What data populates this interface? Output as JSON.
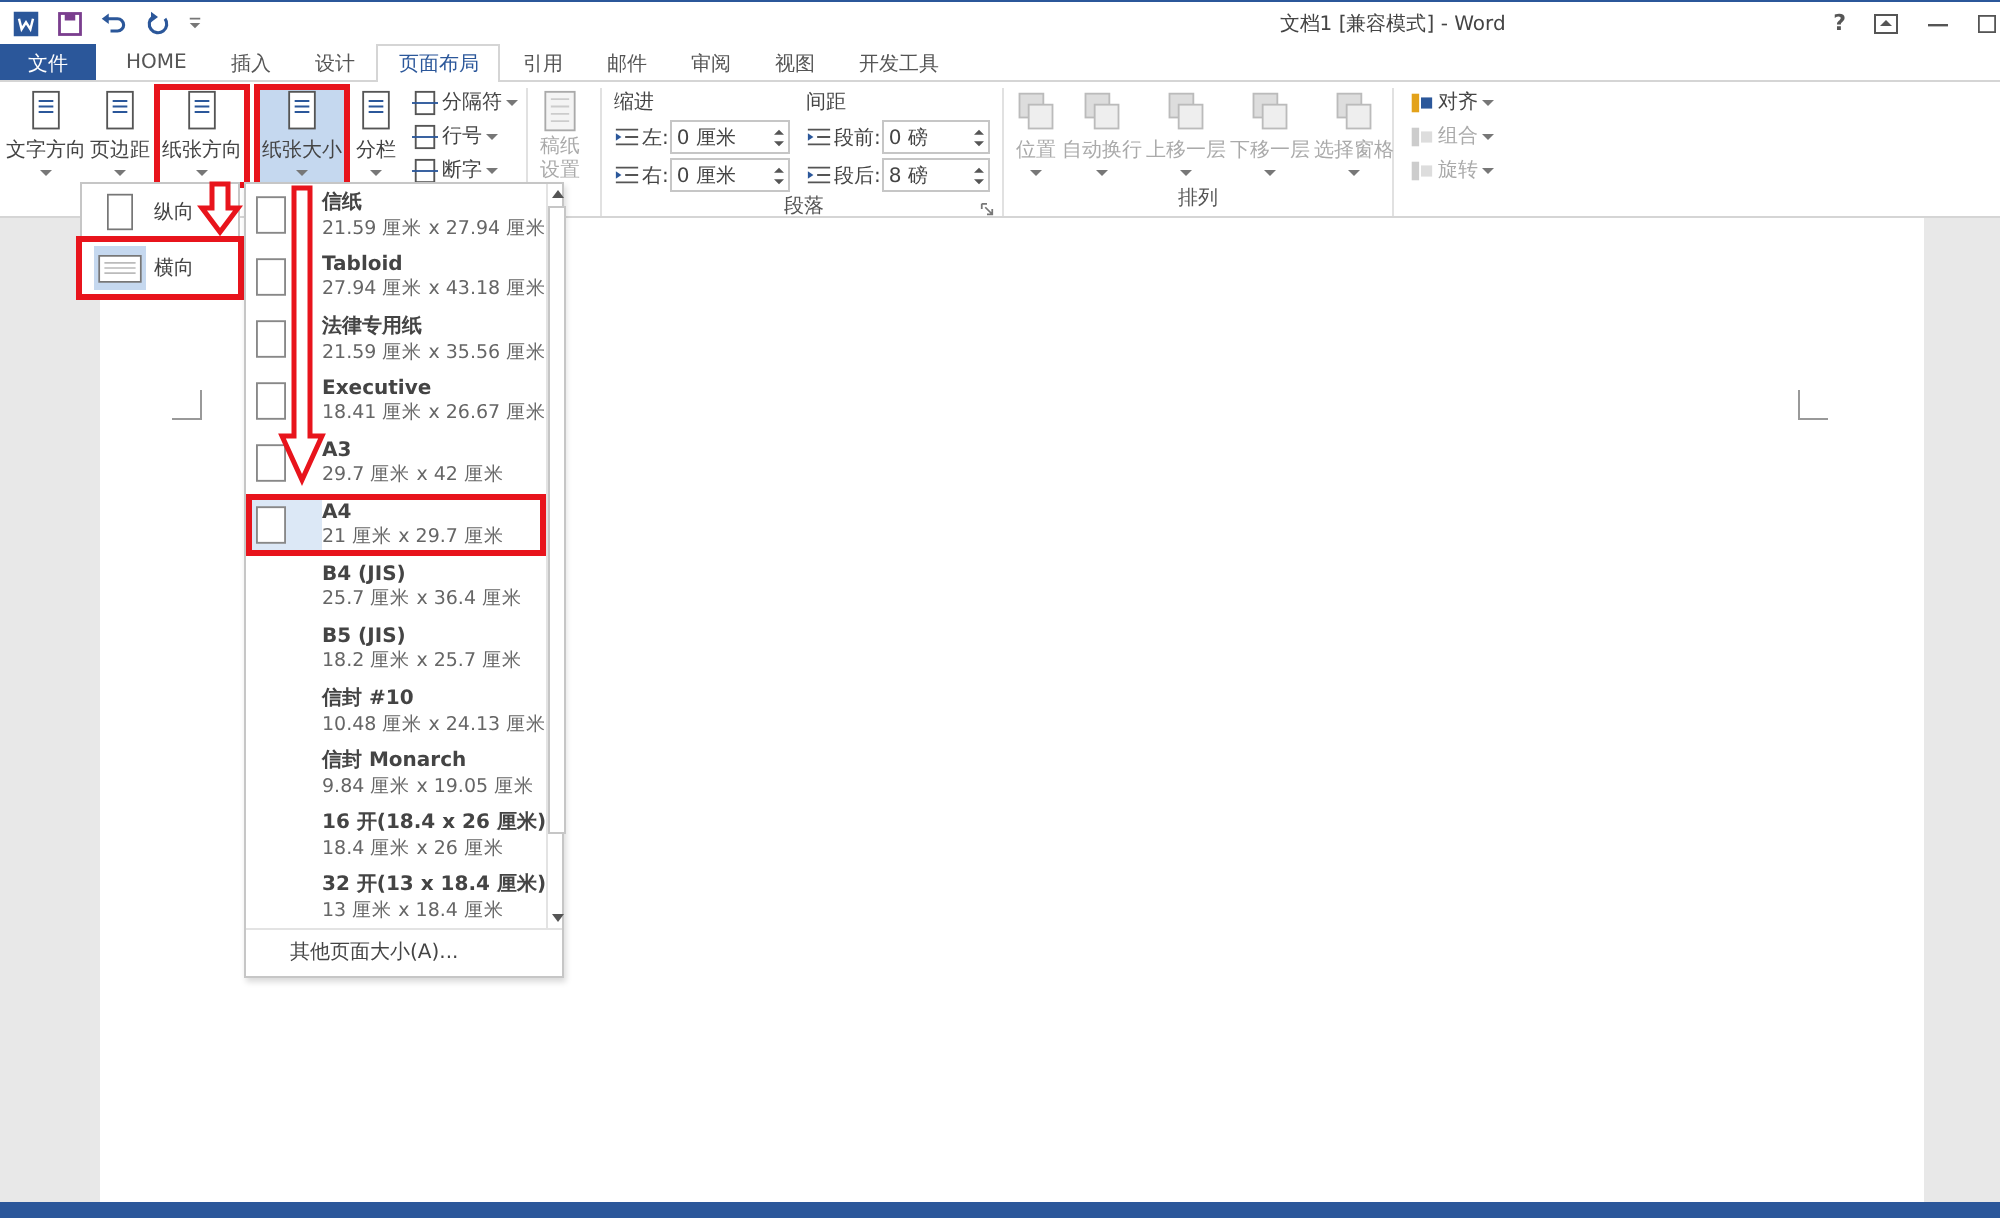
{
  "title_bar": {
    "title": "文档1 [兼容模式] - Word",
    "help": "?"
  },
  "tabs": [
    {
      "label": "文件",
      "kind": "file",
      "selected": false
    },
    {
      "label": "HOME",
      "kind": "tab",
      "selected": false
    },
    {
      "label": "插入",
      "kind": "tab",
      "selected": false
    },
    {
      "label": "设计",
      "kind": "tab",
      "selected": false
    },
    {
      "label": "页面布局",
      "kind": "tab",
      "selected": true
    },
    {
      "label": "引用",
      "kind": "tab",
      "selected": false
    },
    {
      "label": "邮件",
      "kind": "tab",
      "selected": false
    },
    {
      "label": "审阅",
      "kind": "tab",
      "selected": false
    },
    {
      "label": "视图",
      "kind": "tab",
      "selected": false
    },
    {
      "label": "开发工具",
      "kind": "tab",
      "selected": false
    }
  ],
  "ribbon": {
    "page_setup": {
      "large_buttons": [
        {
          "label": "文字方向",
          "pressed": false,
          "annotated": false
        },
        {
          "label": "页边距",
          "pressed": false,
          "annotated": false
        },
        {
          "label": "纸张方向",
          "pressed": false,
          "annotated": true
        },
        {
          "label": "纸张大小",
          "pressed": true,
          "annotated": true
        },
        {
          "label": "分栏",
          "pressed": false,
          "annotated": false
        }
      ],
      "small_buttons": [
        {
          "label": "分隔符"
        },
        {
          "label": "行号"
        },
        {
          "label": "断字"
        }
      ]
    },
    "draft": {
      "label": "稿纸设置",
      "disabled": true
    },
    "paragraph": {
      "label": "段落",
      "indent_title": "缩进",
      "spacing_title": "间距",
      "fields": [
        {
          "label": "左:",
          "value": "0 厘米"
        },
        {
          "label": "段前:",
          "value": "0 磅"
        },
        {
          "label": "右:",
          "value": "0 厘米"
        },
        {
          "label": "段后:",
          "value": "8 磅"
        }
      ]
    },
    "arrange": {
      "label": "排列",
      "large_buttons": [
        {
          "label": "位置",
          "disabled": true
        },
        {
          "label": "自动换行",
          "disabled": true
        },
        {
          "label": "上移一层",
          "disabled": true
        },
        {
          "label": "下移一层",
          "disabled": true
        },
        {
          "label": "选择窗格",
          "disabled": true
        }
      ],
      "small_buttons": [
        {
          "label": "对齐",
          "disabled": false
        },
        {
          "label": "组合",
          "disabled": true
        },
        {
          "label": "旋转",
          "disabled": true
        }
      ]
    }
  },
  "orientation_menu": [
    {
      "label": "纵向",
      "selected": false,
      "annotated": false
    },
    {
      "label": "横向",
      "selected": true,
      "annotated": true
    }
  ],
  "paper_menu": {
    "items": [
      {
        "name": "信纸",
        "size": "21.59 厘米 x 27.94 厘米",
        "thumbnail": true,
        "selected": false,
        "annotated": false
      },
      {
        "name": "Tabloid",
        "size": "27.94 厘米 x 43.18 厘米",
        "thumbnail": true,
        "selected": false,
        "annotated": false
      },
      {
        "name": "法律专用纸",
        "size": "21.59 厘米 x 35.56 厘米",
        "thumbnail": true,
        "selected": false,
        "annotated": false
      },
      {
        "name": "Executive",
        "size": "18.41 厘米 x 26.67 厘米",
        "thumbnail": true,
        "selected": false,
        "annotated": false
      },
      {
        "name": "A3",
        "size": "29.7 厘米 x 42 厘米",
        "thumbnail": true,
        "selected": false,
        "annotated": false
      },
      {
        "name": "A4",
        "size": "21 厘米 x 29.7 厘米",
        "thumbnail": true,
        "selected": true,
        "annotated": true
      },
      {
        "name": "B4 (JIS)",
        "size": "25.7 厘米 x 36.4 厘米",
        "thumbnail": false,
        "selected": false,
        "annotated": false
      },
      {
        "name": "B5 (JIS)",
        "size": "18.2 厘米 x 25.7 厘米",
        "thumbnail": false,
        "selected": false,
        "annotated": false
      },
      {
        "name": "信封 #10",
        "size": "10.48 厘米 x 24.13 厘米",
        "thumbnail": false,
        "selected": false,
        "annotated": false
      },
      {
        "name": "信封 Monarch",
        "size": "9.84 厘米 x 19.05 厘米",
        "thumbnail": false,
        "selected": false,
        "annotated": false
      },
      {
        "name": "16 开(18.4 x 26 厘米)",
        "size": "18.4 厘米 x 26 厘米",
        "thumbnail": false,
        "selected": false,
        "annotated": false
      },
      {
        "name": "32 开(13 x 18.4 厘米)",
        "size": "13 厘米 x 18.4 厘米",
        "thumbnail": false,
        "selected": false,
        "annotated": false
      }
    ],
    "more": "其他页面大小(A)..."
  }
}
